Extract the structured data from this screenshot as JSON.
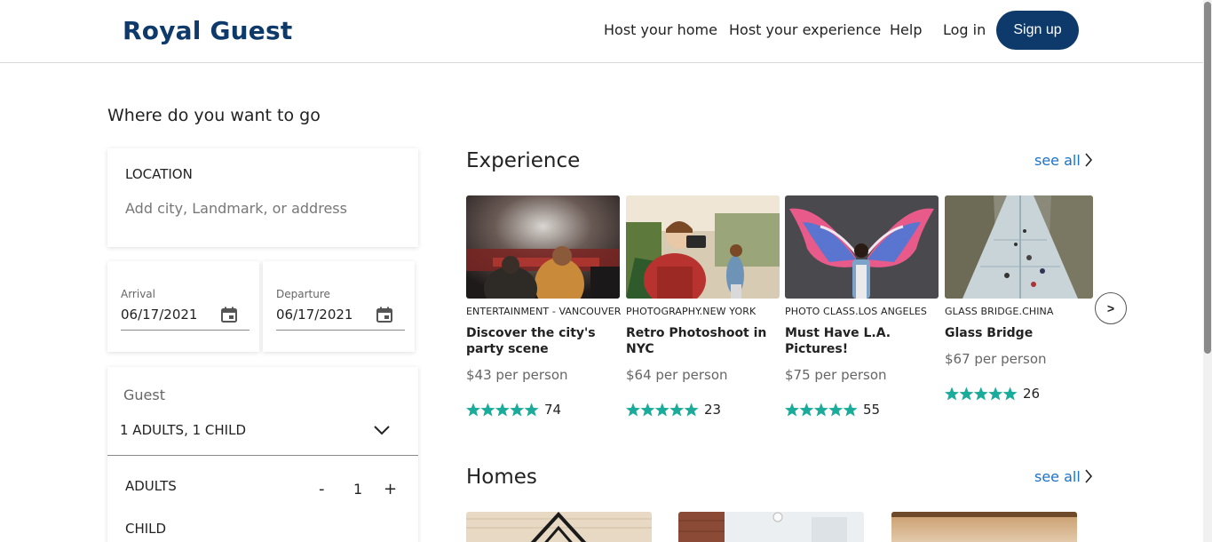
{
  "header": {
    "brand": "Royal Guest",
    "nav": {
      "host_home": "Host your home",
      "host_experience": "Host your experience",
      "help": "Help",
      "login": "Log in",
      "signup": "Sign up"
    }
  },
  "search": {
    "heading": "Where do you want to go",
    "location_label": "LOCATION",
    "location_placeholder": "Add city, Landmark, or address",
    "arrival_label": "Arrival",
    "arrival_value": "06/17/2021",
    "departure_label": "Departure",
    "departure_value": "06/17/2021",
    "guest_label": "Guest",
    "guest_value": "1 ADULTS, 1 CHILD",
    "adults_label": "ADULTS",
    "adults_count": "1",
    "child_label": "CHILD",
    "minus": "-",
    "plus": "+"
  },
  "experience": {
    "title": "Experience",
    "see_all": "see all",
    "next": ">",
    "items": [
      {
        "category": "ENTERTAINMENT - VANCOUVER",
        "title": "Discover the city's party scene",
        "price": "$43 per person",
        "rating": 5,
        "reviews": "74"
      },
      {
        "category": "PHOTOGRAPHY.NEW YORK",
        "title": "Retro Photoshoot in NYC",
        "price": "$64 per person",
        "rating": 5,
        "reviews": "23"
      },
      {
        "category": "PHOTO CLASS.LOS ANGELES",
        "title": "Must Have L.A. Pictures!",
        "price": "$75 per person",
        "rating": 5,
        "reviews": "55"
      },
      {
        "category": "GLASS BRIDGE.CHINA",
        "title": "Glass Bridge",
        "price": "$67 per person",
        "rating": 5,
        "reviews": "26"
      }
    ]
  },
  "homes": {
    "title": "Homes",
    "see_all": "see all"
  },
  "colors": {
    "brand": "#0d3a6b",
    "link": "#1a73c9",
    "star": "#1aab9b"
  }
}
